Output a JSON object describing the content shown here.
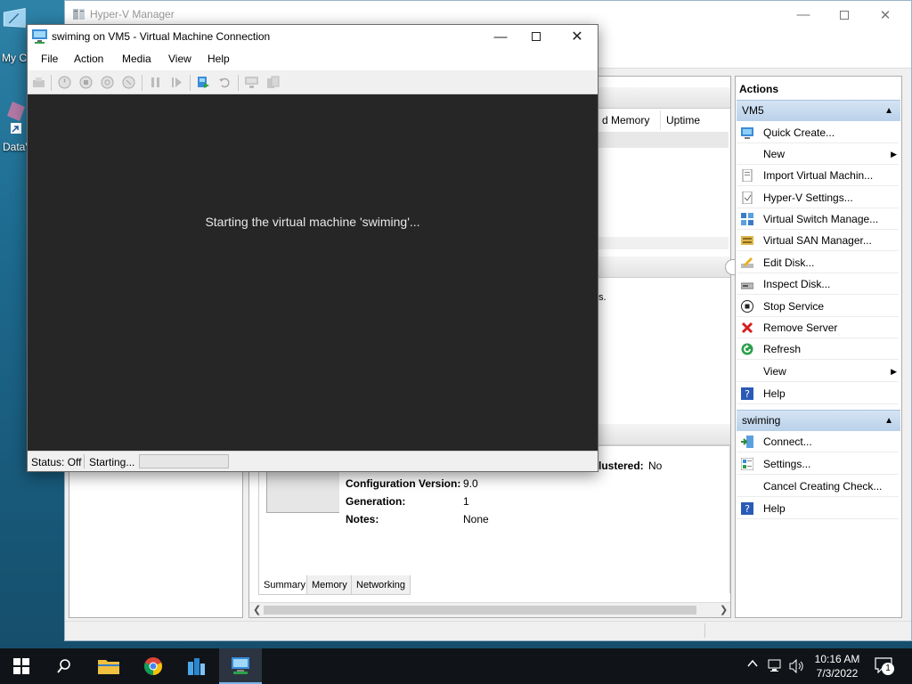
{
  "desktop": {
    "icon1_label": "My C",
    "icon2_label": "DataV"
  },
  "hyperv": {
    "title": "Hyper-V Manager",
    "columns": [
      "d Memory",
      "Uptime"
    ],
    "fragment_text": "s.",
    "details": {
      "clustered_label": "lustered:",
      "clustered_value": "No",
      "config_version_label": "Configuration Version:",
      "config_version_value": "9.0",
      "generation_label": "Generation:",
      "generation_value": "1",
      "notes_label": "Notes:",
      "notes_value": "None"
    },
    "bottom_tabs": [
      "Summary",
      "Memory",
      "Networking"
    ],
    "actions": {
      "title": "Actions",
      "group1": "VM5",
      "group1_items": [
        {
          "label": "Quick Create...",
          "icon": "quick-create-icon"
        },
        {
          "label": "New",
          "icon": "",
          "submenu": true
        },
        {
          "label": "Import Virtual Machin...",
          "icon": "import-vm-icon"
        },
        {
          "label": "Hyper-V Settings...",
          "icon": "settings-page-icon"
        },
        {
          "label": "Virtual Switch Manage...",
          "icon": "virtual-switch-icon"
        },
        {
          "label": "Virtual SAN Manager...",
          "icon": "virtual-san-icon"
        },
        {
          "label": "Edit Disk...",
          "icon": "edit-disk-icon"
        },
        {
          "label": "Inspect Disk...",
          "icon": "inspect-disk-icon"
        },
        {
          "label": "Stop Service",
          "icon": "stop-service-icon"
        },
        {
          "label": "Remove Server",
          "icon": "remove-red-x-icon"
        },
        {
          "label": "Refresh",
          "icon": "refresh-green-icon"
        },
        {
          "label": "View",
          "icon": "",
          "submenu": true
        },
        {
          "label": "Help",
          "icon": "help-icon"
        }
      ],
      "group2": "swiming",
      "group2_items": [
        {
          "label": "Connect...",
          "icon": "connect-icon"
        },
        {
          "label": "Settings...",
          "icon": "vm-settings-icon"
        },
        {
          "label": "Cancel Creating Check...",
          "icon": ""
        },
        {
          "label": "Help",
          "icon": "help-icon"
        }
      ]
    }
  },
  "vmconnect": {
    "title": "swiming on VM5 - Virtual Machine Connection",
    "menu": [
      "File",
      "Action",
      "Media",
      "View",
      "Help"
    ],
    "message": "Starting the virtual machine 'swiming'...",
    "status_label": "Status: Off",
    "status_activity": "Starting..."
  },
  "taskbar": {
    "time": "10:16 AM",
    "date": "7/3/2022",
    "notification_count": "1"
  }
}
